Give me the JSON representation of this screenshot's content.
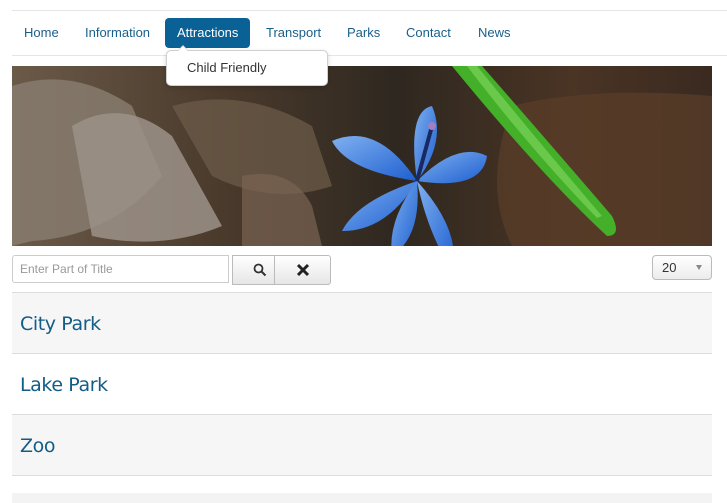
{
  "nav": {
    "items": [
      {
        "label": "Home",
        "active": false
      },
      {
        "label": "Information",
        "active": false
      },
      {
        "label": "Attractions",
        "active": true
      },
      {
        "label": "Transport",
        "active": false
      },
      {
        "label": "Parks",
        "active": false
      },
      {
        "label": "Contact",
        "active": false
      },
      {
        "label": "News",
        "active": false
      }
    ],
    "dropdown": {
      "parent": "Attractions",
      "items": [
        {
          "label": "Child Friendly"
        }
      ]
    }
  },
  "banner": {
    "description": "blue flower among dry leaves with green blade of grass"
  },
  "filter": {
    "placeholder": "Enter Part of Title",
    "value": "",
    "search_icon": "search-icon",
    "clear_icon": "close-icon"
  },
  "limit": {
    "selected": "20"
  },
  "articles": [
    {
      "title": "City Park"
    },
    {
      "title": "Lake Park"
    },
    {
      "title": "Zoo"
    }
  ],
  "colors": {
    "accent": "#0a6196",
    "link": "#125c85"
  }
}
